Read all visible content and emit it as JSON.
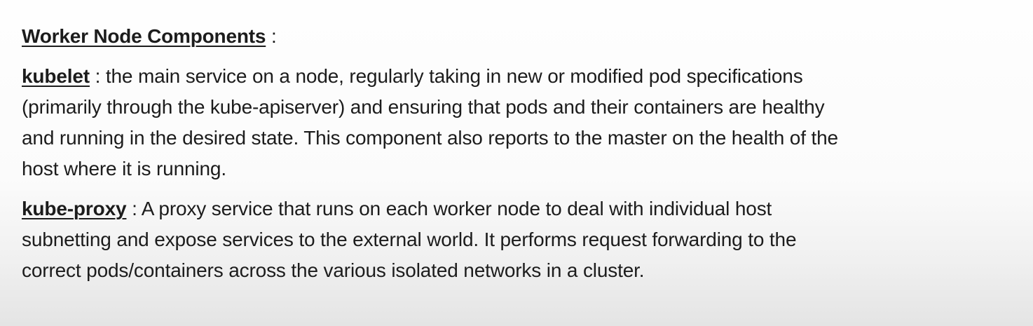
{
  "heading": {
    "title": "Worker Node Components",
    "suffix": " :"
  },
  "kubelet": {
    "term": "kubelet",
    "lines": [
      " : the main service on a node, regularly taking in new or modified pod specifications",
      "(primarily through the kube-apiserver) and ensuring that pods and their containers are healthy",
      "and running in the desired state. This component also reports to the master on the health of the",
      "host where it is running."
    ]
  },
  "kube_proxy": {
    "term": "kube-proxy",
    "lines": [
      " : A proxy service that runs on each worker node to deal with individual host",
      "subnetting and expose services to the external world. It performs request forwarding to the",
      "correct pods/containers across the various isolated networks in a cluster."
    ]
  }
}
